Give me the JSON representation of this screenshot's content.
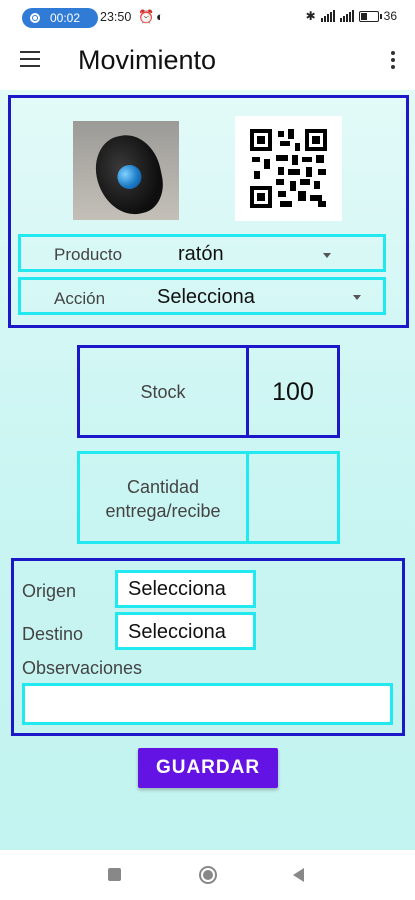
{
  "status_bar": {
    "pill_time": "00:02",
    "time": "23:50",
    "battery": "36"
  },
  "app_bar": {
    "title": "Movimiento"
  },
  "product_panel": {
    "producto_label": "Producto",
    "producto_value": "ratón",
    "accion_label": "Acción",
    "accion_value": "Selecciona"
  },
  "stock_panel": {
    "stock_label": "Stock",
    "stock_value": "100"
  },
  "cantidad_panel": {
    "cantidad_label_line1": "Cantidad",
    "cantidad_label_line2": "entrega/recibe",
    "cantidad_value": ""
  },
  "location_panel": {
    "origen_label": "Origen",
    "origen_value": "Selecciona",
    "destino_label": "Destino",
    "destino_value": "Selecciona",
    "observaciones_label": "Observaciones",
    "observaciones_value": ""
  },
  "save_button": {
    "label": "GUARDAR"
  },
  "colors": {
    "panel_border": "#1c17c9",
    "field_border": "#22e9f0",
    "button": "#6413e5"
  }
}
